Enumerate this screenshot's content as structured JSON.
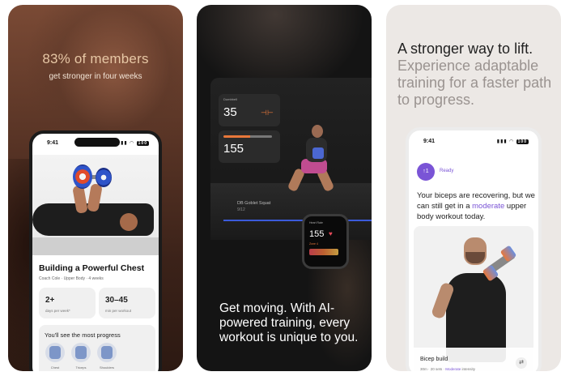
{
  "panel1": {
    "headline": "83% of members",
    "subhead": "get stronger in four weeks",
    "phone": {
      "status_time": "9:41",
      "battery": "100",
      "program_title": "Building a Powerful Chest",
      "program_meta": "Coach Cole · Upper Body · 4 weeks",
      "stats": [
        {
          "value": "2+",
          "label": "days per week*"
        },
        {
          "value": "30–45",
          "label": "min per workout"
        }
      ],
      "progress_title": "You'll see the most progress",
      "muscles": [
        "Chest",
        "Triceps",
        "Shoulders"
      ]
    }
  },
  "panel2": {
    "cards": [
      {
        "label": "Dumbbell",
        "value": "35"
      },
      {
        "label": "",
        "value": "155"
      }
    ],
    "exercise_name": "DB Goblet Squat",
    "exercise_count": "9/12",
    "watch": {
      "label": "Heart Rate",
      "bpm": "155",
      "zone": "Zone 4"
    },
    "caption": "Get moving. With AI-powered training, every workout is unique to you."
  },
  "panel3": {
    "headline": "A stronger way to lift.",
    "subhead": "Experience adaptable training for a faster path to progress.",
    "phone": {
      "status_time": "9:41",
      "battery": "100",
      "badge_number": "↑1",
      "badge_label": "Ready",
      "message_before": "Your biceps are recovering, but we can still get in a ",
      "message_highlight": "moderate",
      "message_after": " upper body workout today.",
      "workout_name": "Bicep build",
      "workout_meta_prefix": "30m · 20 sets · ",
      "workout_meta_highlight": "Moderate",
      "workout_meta_suffix": " intensity"
    }
  },
  "colors": {
    "accent_purple": "#7a54d6",
    "accent_blue": "#3b5bdb",
    "accent_orange": "#e8773a",
    "headline_tan": "#e7c7a5"
  }
}
